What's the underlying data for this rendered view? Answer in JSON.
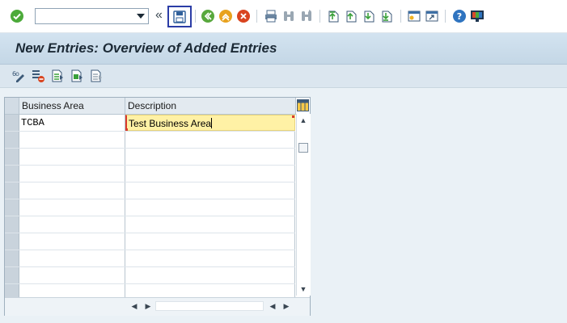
{
  "toolbar": {
    "command_field_value": "",
    "icons": [
      "enter-icon",
      "save-icon",
      "back-icon",
      "exit-icon",
      "cancel-icon",
      "print-icon",
      "find-icon",
      "find-next-icon",
      "first-page-icon",
      "previous-page-icon",
      "next-page-icon",
      "last-page-icon",
      "create-session-icon",
      "shortcut-icon",
      "help-icon",
      "customize-layout-icon"
    ],
    "colors": {
      "enter": "#4caa3a",
      "save_box": "#2b3ca6",
      "back": "#58a83d",
      "exit": "#e8a21e",
      "cancel": "#d9441f",
      "help": "#2f74c0"
    }
  },
  "title": "New Entries: Overview of Added Entries",
  "table": {
    "columns": [
      "Business Area",
      "Description"
    ],
    "rows": [
      {
        "business_area": "TCBA",
        "description": "Test Business Area"
      },
      {
        "business_area": "",
        "description": ""
      },
      {
        "business_area": "",
        "description": ""
      },
      {
        "business_area": "",
        "description": ""
      },
      {
        "business_area": "",
        "description": ""
      },
      {
        "business_area": "",
        "description": ""
      },
      {
        "business_area": "",
        "description": ""
      },
      {
        "business_area": "",
        "description": ""
      },
      {
        "business_area": "",
        "description": ""
      },
      {
        "business_area": "",
        "description": ""
      },
      {
        "business_area": "",
        "description": ""
      }
    ],
    "active_cell_color": "#fff1a5"
  }
}
